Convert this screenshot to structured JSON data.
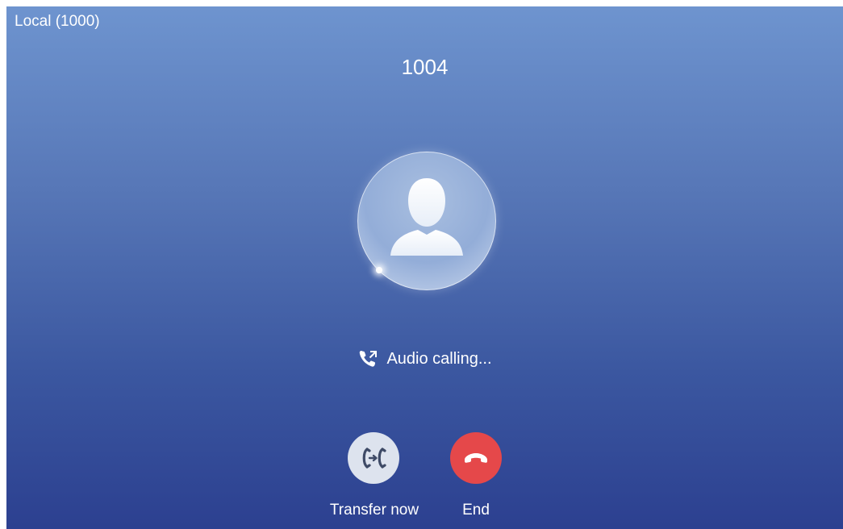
{
  "header": {
    "account_label": "Local (1000)"
  },
  "call": {
    "callee": "1004",
    "status_text": "Audio calling...",
    "status_icon": "outgoing-call-icon",
    "avatar_icon": "default-contact-avatar-icon"
  },
  "actions": {
    "transfer": {
      "label": "Transfer now",
      "icon": "transfer-icon",
      "color": "#dde3ee"
    },
    "end": {
      "label": "End",
      "icon": "hang-up-icon",
      "color": "#e5484a"
    }
  },
  "colors": {
    "background_top": "#6e94cf",
    "background_bottom": "#2c4090",
    "text": "#ffffff"
  }
}
